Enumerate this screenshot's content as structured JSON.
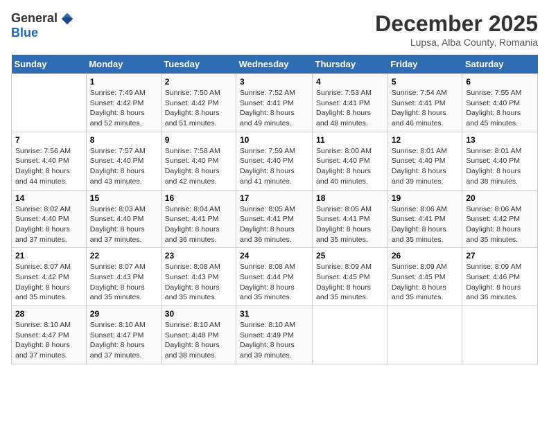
{
  "logo": {
    "general": "General",
    "blue": "Blue"
  },
  "title": "December 2025",
  "subtitle": "Lupsa, Alba County, Romania",
  "days_of_week": [
    "Sunday",
    "Monday",
    "Tuesday",
    "Wednesday",
    "Thursday",
    "Friday",
    "Saturday"
  ],
  "weeks": [
    [
      {
        "day": "",
        "sunrise": "",
        "sunset": "",
        "daylight": ""
      },
      {
        "day": "1",
        "sunrise": "Sunrise: 7:49 AM",
        "sunset": "Sunset: 4:42 PM",
        "daylight": "Daylight: 8 hours and 52 minutes."
      },
      {
        "day": "2",
        "sunrise": "Sunrise: 7:50 AM",
        "sunset": "Sunset: 4:42 PM",
        "daylight": "Daylight: 8 hours and 51 minutes."
      },
      {
        "day": "3",
        "sunrise": "Sunrise: 7:52 AM",
        "sunset": "Sunset: 4:41 PM",
        "daylight": "Daylight: 8 hours and 49 minutes."
      },
      {
        "day": "4",
        "sunrise": "Sunrise: 7:53 AM",
        "sunset": "Sunset: 4:41 PM",
        "daylight": "Daylight: 8 hours and 48 minutes."
      },
      {
        "day": "5",
        "sunrise": "Sunrise: 7:54 AM",
        "sunset": "Sunset: 4:41 PM",
        "daylight": "Daylight: 8 hours and 46 minutes."
      },
      {
        "day": "6",
        "sunrise": "Sunrise: 7:55 AM",
        "sunset": "Sunset: 4:40 PM",
        "daylight": "Daylight: 8 hours and 45 minutes."
      }
    ],
    [
      {
        "day": "7",
        "sunrise": "Sunrise: 7:56 AM",
        "sunset": "Sunset: 4:40 PM",
        "daylight": "Daylight: 8 hours and 44 minutes."
      },
      {
        "day": "8",
        "sunrise": "Sunrise: 7:57 AM",
        "sunset": "Sunset: 4:40 PM",
        "daylight": "Daylight: 8 hours and 43 minutes."
      },
      {
        "day": "9",
        "sunrise": "Sunrise: 7:58 AM",
        "sunset": "Sunset: 4:40 PM",
        "daylight": "Daylight: 8 hours and 42 minutes."
      },
      {
        "day": "10",
        "sunrise": "Sunrise: 7:59 AM",
        "sunset": "Sunset: 4:40 PM",
        "daylight": "Daylight: 8 hours and 41 minutes."
      },
      {
        "day": "11",
        "sunrise": "Sunrise: 8:00 AM",
        "sunset": "Sunset: 4:40 PM",
        "daylight": "Daylight: 8 hours and 40 minutes."
      },
      {
        "day": "12",
        "sunrise": "Sunrise: 8:01 AM",
        "sunset": "Sunset: 4:40 PM",
        "daylight": "Daylight: 8 hours and 39 minutes."
      },
      {
        "day": "13",
        "sunrise": "Sunrise: 8:01 AM",
        "sunset": "Sunset: 4:40 PM",
        "daylight": "Daylight: 8 hours and 38 minutes."
      }
    ],
    [
      {
        "day": "14",
        "sunrise": "Sunrise: 8:02 AM",
        "sunset": "Sunset: 4:40 PM",
        "daylight": "Daylight: 8 hours and 37 minutes."
      },
      {
        "day": "15",
        "sunrise": "Sunrise: 8:03 AM",
        "sunset": "Sunset: 4:40 PM",
        "daylight": "Daylight: 8 hours and 37 minutes."
      },
      {
        "day": "16",
        "sunrise": "Sunrise: 8:04 AM",
        "sunset": "Sunset: 4:41 PM",
        "daylight": "Daylight: 8 hours and 36 minutes."
      },
      {
        "day": "17",
        "sunrise": "Sunrise: 8:05 AM",
        "sunset": "Sunset: 4:41 PM",
        "daylight": "Daylight: 8 hours and 36 minutes."
      },
      {
        "day": "18",
        "sunrise": "Sunrise: 8:05 AM",
        "sunset": "Sunset: 4:41 PM",
        "daylight": "Daylight: 8 hours and 35 minutes."
      },
      {
        "day": "19",
        "sunrise": "Sunrise: 8:06 AM",
        "sunset": "Sunset: 4:41 PM",
        "daylight": "Daylight: 8 hours and 35 minutes."
      },
      {
        "day": "20",
        "sunrise": "Sunrise: 8:06 AM",
        "sunset": "Sunset: 4:42 PM",
        "daylight": "Daylight: 8 hours and 35 minutes."
      }
    ],
    [
      {
        "day": "21",
        "sunrise": "Sunrise: 8:07 AM",
        "sunset": "Sunset: 4:42 PM",
        "daylight": "Daylight: 8 hours and 35 minutes."
      },
      {
        "day": "22",
        "sunrise": "Sunrise: 8:07 AM",
        "sunset": "Sunset: 4:43 PM",
        "daylight": "Daylight: 8 hours and 35 minutes."
      },
      {
        "day": "23",
        "sunrise": "Sunrise: 8:08 AM",
        "sunset": "Sunset: 4:43 PM",
        "daylight": "Daylight: 8 hours and 35 minutes."
      },
      {
        "day": "24",
        "sunrise": "Sunrise: 8:08 AM",
        "sunset": "Sunset: 4:44 PM",
        "daylight": "Daylight: 8 hours and 35 minutes."
      },
      {
        "day": "25",
        "sunrise": "Sunrise: 8:09 AM",
        "sunset": "Sunset: 4:45 PM",
        "daylight": "Daylight: 8 hours and 35 minutes."
      },
      {
        "day": "26",
        "sunrise": "Sunrise: 8:09 AM",
        "sunset": "Sunset: 4:45 PM",
        "daylight": "Daylight: 8 hours and 35 minutes."
      },
      {
        "day": "27",
        "sunrise": "Sunrise: 8:09 AM",
        "sunset": "Sunset: 4:46 PM",
        "daylight": "Daylight: 8 hours and 36 minutes."
      }
    ],
    [
      {
        "day": "28",
        "sunrise": "Sunrise: 8:10 AM",
        "sunset": "Sunset: 4:47 PM",
        "daylight": "Daylight: 8 hours and 37 minutes."
      },
      {
        "day": "29",
        "sunrise": "Sunrise: 8:10 AM",
        "sunset": "Sunset: 4:47 PM",
        "daylight": "Daylight: 8 hours and 37 minutes."
      },
      {
        "day": "30",
        "sunrise": "Sunrise: 8:10 AM",
        "sunset": "Sunset: 4:48 PM",
        "daylight": "Daylight: 8 hours and 38 minutes."
      },
      {
        "day": "31",
        "sunrise": "Sunrise: 8:10 AM",
        "sunset": "Sunset: 4:49 PM",
        "daylight": "Daylight: 8 hours and 39 minutes."
      },
      {
        "day": "",
        "sunrise": "",
        "sunset": "",
        "daylight": ""
      },
      {
        "day": "",
        "sunrise": "",
        "sunset": "",
        "daylight": ""
      },
      {
        "day": "",
        "sunrise": "",
        "sunset": "",
        "daylight": ""
      }
    ]
  ]
}
